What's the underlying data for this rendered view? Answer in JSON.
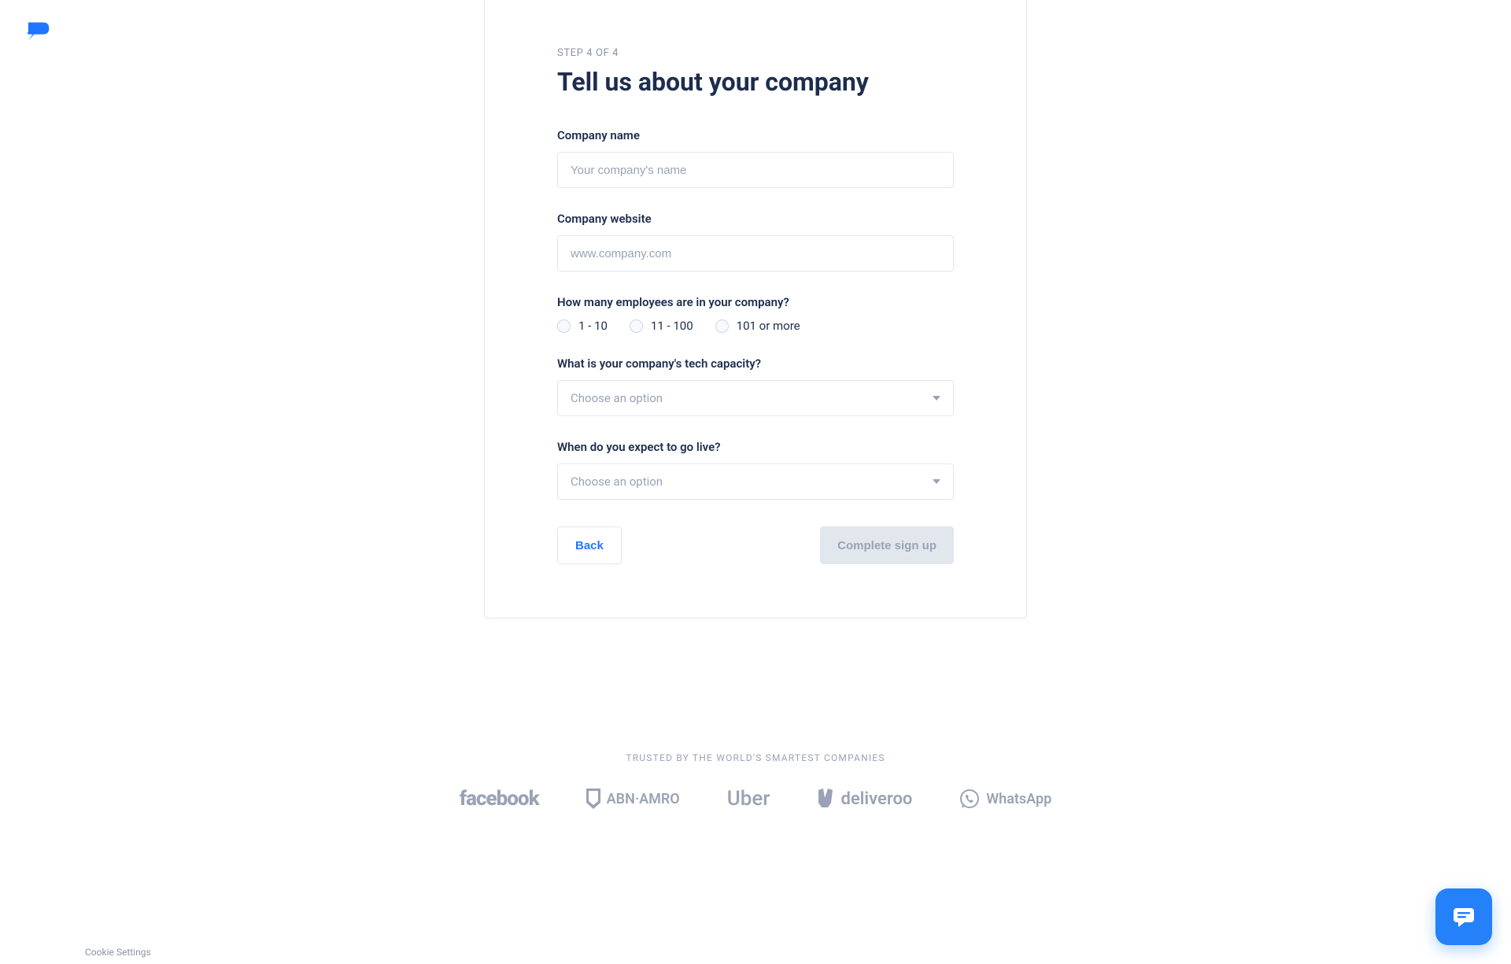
{
  "logo": {
    "name": "messagebird-logo"
  },
  "card": {
    "step_label": "STEP 4 OF 4",
    "title": "Tell us about your company",
    "company_name": {
      "label": "Company name",
      "placeholder": "Your company's name",
      "value": ""
    },
    "company_website": {
      "label": "Company website",
      "placeholder": "www.company.com",
      "value": ""
    },
    "employees": {
      "label": "How many employees are in your company?",
      "options": [
        "1 - 10",
        "11 - 100",
        "101 or more"
      ]
    },
    "tech_capacity": {
      "label": "What is your company's tech capacity?",
      "placeholder": "Choose an option"
    },
    "go_live": {
      "label": "When do you expect to go live?",
      "placeholder": "Choose an option"
    },
    "buttons": {
      "back": "Back",
      "submit": "Complete sign up"
    }
  },
  "trusted": {
    "label": "TRUSTED BY THE WORLD'S SMARTEST COMPANIES",
    "logos": [
      "facebook",
      "ABN·AMRO",
      "Uber",
      "deliveroo",
      "WhatsApp"
    ]
  },
  "footer": {
    "cookie_settings": "Cookie Settings"
  }
}
